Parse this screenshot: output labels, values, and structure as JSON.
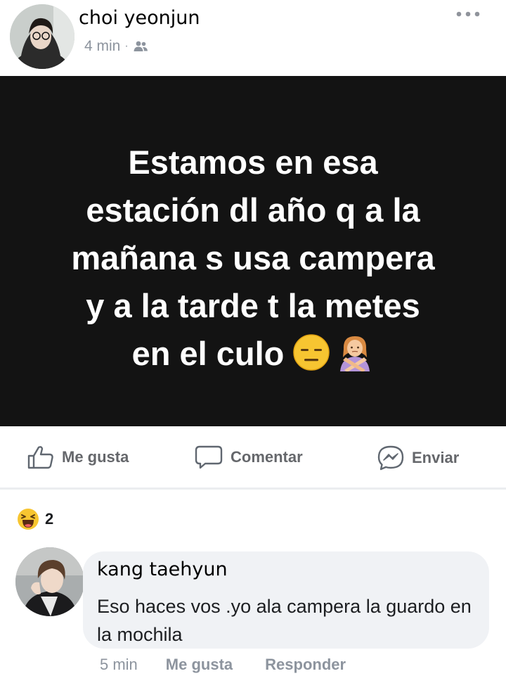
{
  "post": {
    "author_name": "choi yeonjun",
    "time": "4 min",
    "separator": "·",
    "audience_icon": "friends-icon",
    "more_icon": "more-dots-icon",
    "text": "Estamos en esa\nestación dl año q a la\nmañana s usa campera\ny a la tarde t la metes\nen el culo",
    "emojis": [
      "expressionless-face-emoji",
      "person-gesturing-no-emoji"
    ],
    "background_color": "#131313",
    "text_color": "#ffffff"
  },
  "actions": {
    "like_label": "Me gusta",
    "comment_label": "Comentar",
    "send_label": "Enviar"
  },
  "reactions": {
    "icon": "haha-reaction-icon",
    "count": "2"
  },
  "comment": {
    "author_name": "kang taehyun",
    "text": "Eso  haces vos .yo ala campera la guardo en la mochila",
    "time": "5 min",
    "like_label": "Me gusta",
    "reply_label": "Responder",
    "bubble_color": "#f0f2f5"
  },
  "colors": {
    "secondary_text": "#8d949e",
    "action_text": "#65676b"
  }
}
